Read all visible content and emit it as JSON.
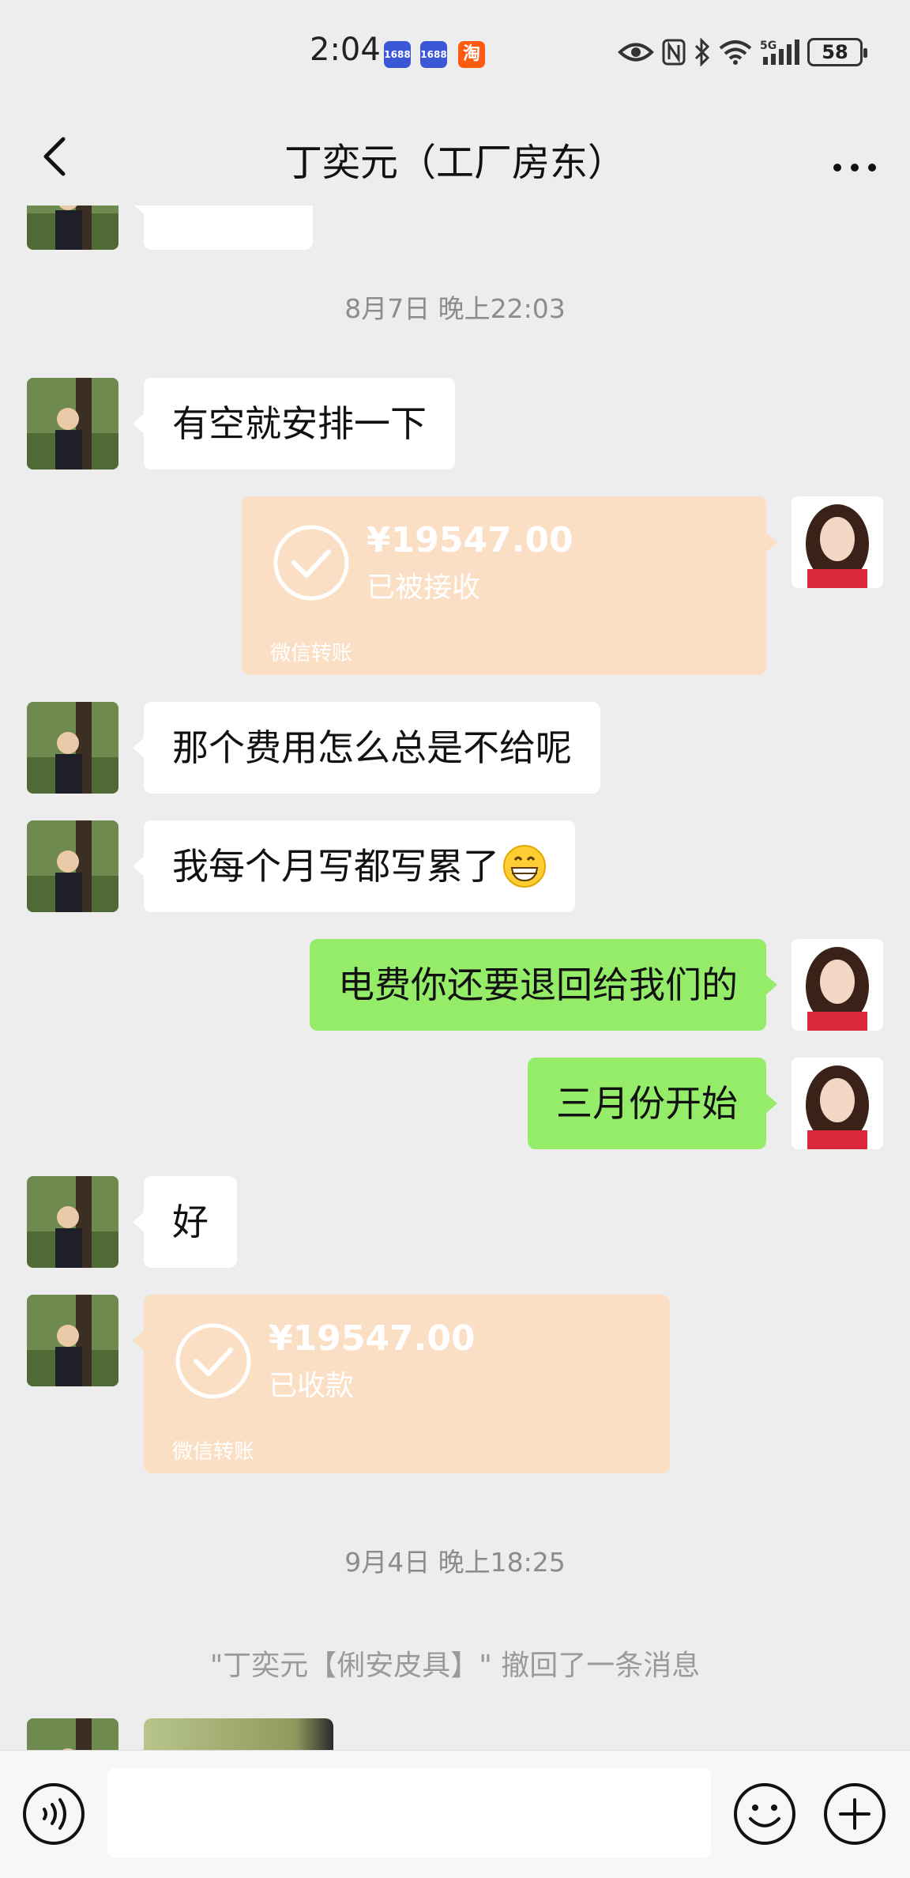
{
  "status_bar": {
    "time": "2:04",
    "apps": [
      {
        "icon": "app-1688-icon",
        "label": "1688",
        "color": "#3c57d6"
      },
      {
        "icon": "app-1688-icon",
        "label": "1688",
        "color": "#3c57d6"
      },
      {
        "icon": "taobao-icon",
        "label": "淘",
        "color": "#ff5b10"
      }
    ],
    "battery": "58"
  },
  "nav": {
    "title": "丁奕元（工厂房东）"
  },
  "chat": {
    "timestamps": [
      "8月7日 晚上22:03",
      "9月4日 晚上18:25"
    ],
    "messages": [
      {
        "side": "in",
        "text": "有空就安排一下"
      },
      {
        "side": "out",
        "type": "transfer",
        "amount": "¥19547.00",
        "status": "已被接收",
        "brand": "微信转账"
      },
      {
        "side": "in",
        "text": "那个费用怎么总是不给呢"
      },
      {
        "side": "in",
        "text": "我每个月写都写累了",
        "emoji": "grinning-face-emoji"
      },
      {
        "side": "out",
        "text": "电费你还要退回给我们的"
      },
      {
        "side": "out",
        "text": "三月份开始"
      },
      {
        "side": "in",
        "text": "好"
      },
      {
        "side": "in",
        "type": "transfer",
        "amount": "¥19547.00",
        "status": "已收款",
        "brand": "微信转账"
      }
    ],
    "system_message": "\"丁奕元【俐安皮具】\" 撤回了一条消息"
  },
  "colors": {
    "background": "#ededed",
    "bubble_out": "#95ec69",
    "bubble_in": "#ffffff",
    "transfer_card": "#fbdfc4"
  }
}
